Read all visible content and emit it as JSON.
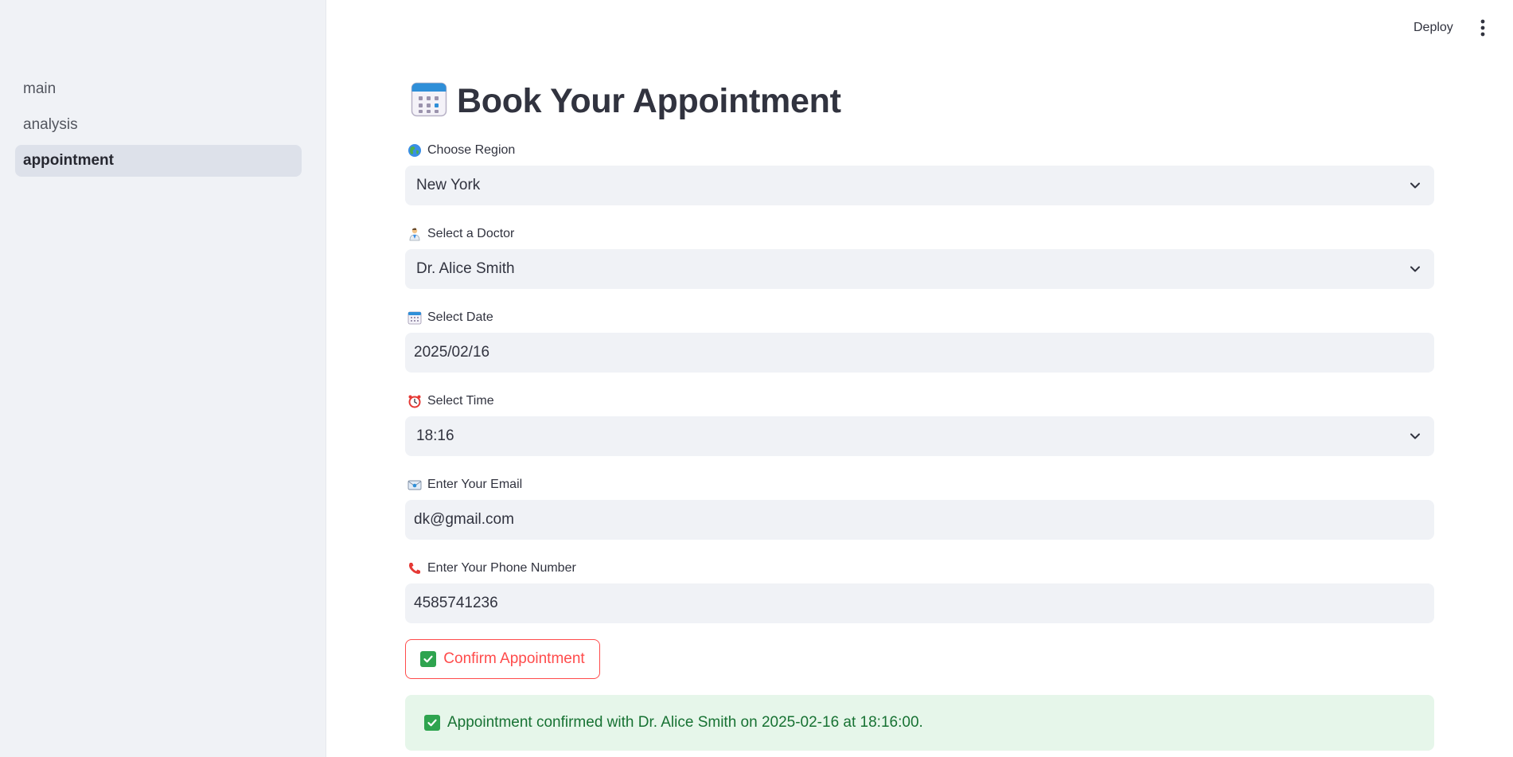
{
  "sidebar": {
    "items": [
      {
        "label": "main"
      },
      {
        "label": "analysis"
      },
      {
        "label": "appointment"
      }
    ]
  },
  "topbar": {
    "deploy_label": "Deploy"
  },
  "page": {
    "title": "Book Your Appointment"
  },
  "form": {
    "region": {
      "label": "Choose Region",
      "value": "New York"
    },
    "doctor": {
      "label": "Select a Doctor",
      "value": "Dr. Alice Smith"
    },
    "date": {
      "label": "Select Date",
      "value": "2025/02/16"
    },
    "time": {
      "label": "Select Time",
      "value": "18:16"
    },
    "email": {
      "label": "Enter Your Email",
      "value": "dk@gmail.com"
    },
    "phone": {
      "label": "Enter Your Phone Number",
      "value": "4585741236"
    },
    "confirm_label": "Confirm Appointment"
  },
  "alert": {
    "message": "Appointment confirmed with Dr. Alice Smith on 2025-02-16 at 18:16:00."
  },
  "colors": {
    "accent": "#ff4b4b",
    "success_bg": "#e6f6ea",
    "success_text": "#177233",
    "sidebar_bg": "#f0f2f6"
  },
  "icons": [
    "calendar-icon",
    "globe-icon",
    "doctor-icon",
    "calendar-small-icon",
    "alarm-clock-icon",
    "email-icon",
    "phone-icon",
    "check-icon",
    "chevron-down-icon",
    "more-vert-icon"
  ]
}
